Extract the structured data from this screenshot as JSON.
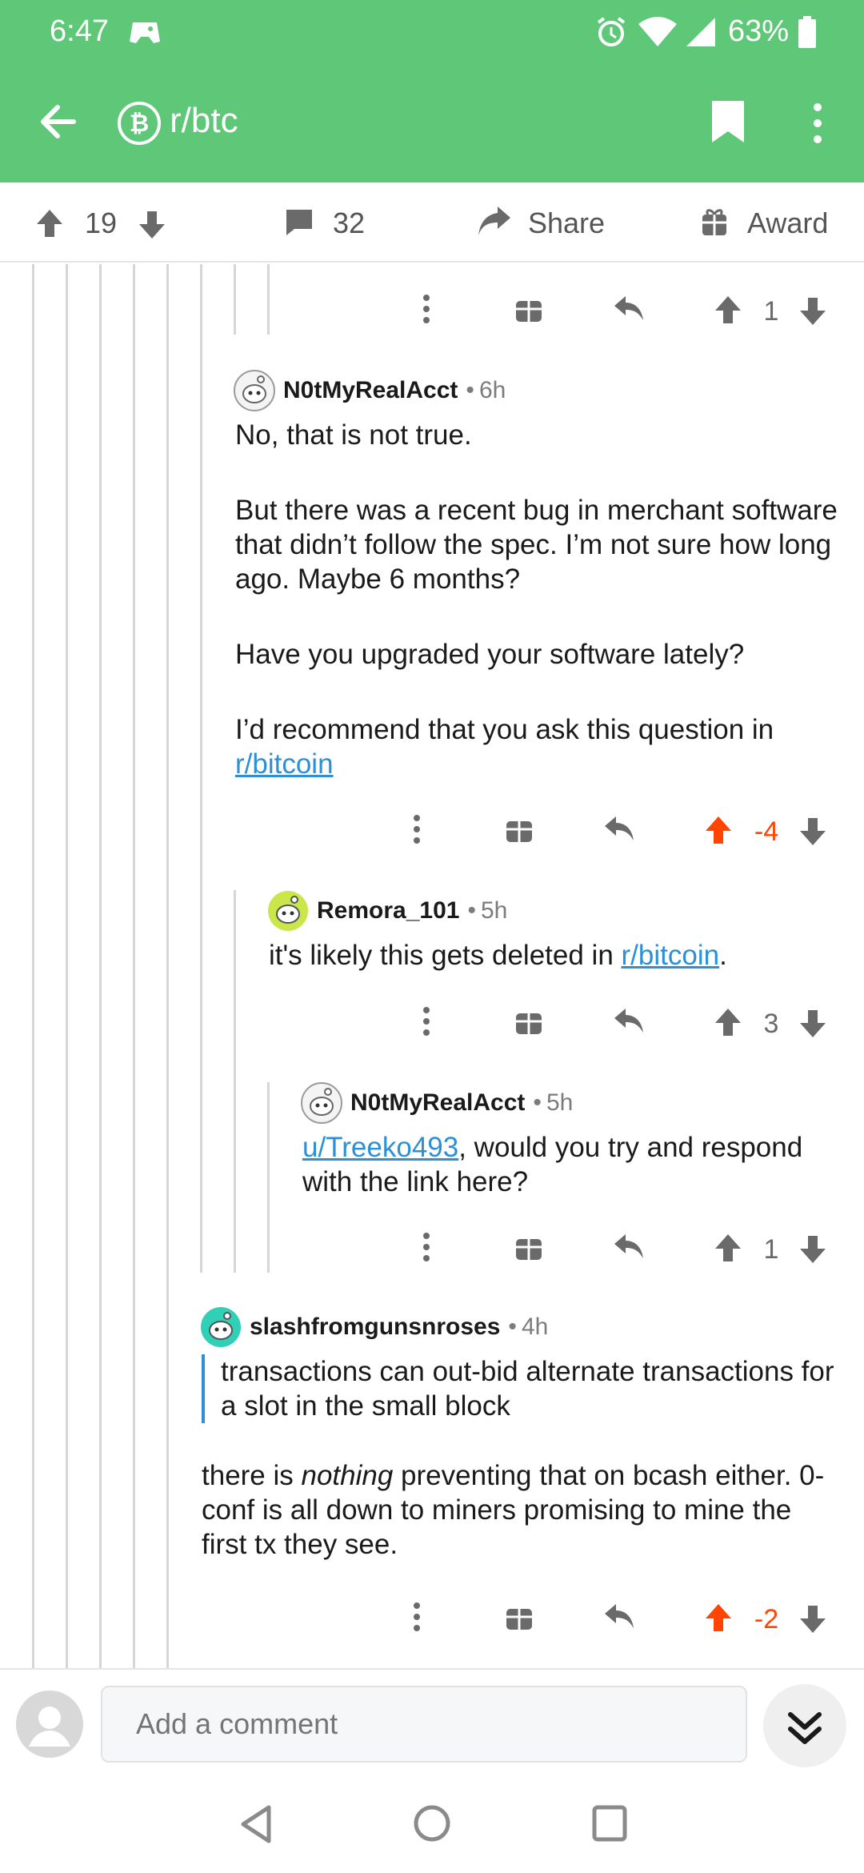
{
  "status_bar": {
    "time": "6:47",
    "battery": "63%"
  },
  "app_bar": {
    "subreddit": "r/btc",
    "back_icon": "arrow-left-icon",
    "bookmark_icon": "bookmark-icon",
    "menu_icon": "more-vert-icon"
  },
  "post_actions": {
    "score": "19",
    "comments": "32",
    "share_label": "Share",
    "award_label": "Award"
  },
  "comments": [
    {
      "id": "c0",
      "score": "1",
      "score_state": "neutral"
    },
    {
      "id": "c1",
      "author": "N0tMyRealAcct",
      "age": "6h",
      "paragraphs": [
        "No, that is not true.",
        "But there was a recent bug in merchant software that didn’t follow the spec. I’m not sure how long ago. Maybe 6 months?",
        "Have you upgraded your software lately?"
      ],
      "last_text": "I’d recommend that you ask this question in ",
      "last_link": "r/bitcoin",
      "score": "-4",
      "score_state": "upvoted"
    },
    {
      "id": "c2",
      "author": "Remora_101",
      "age": "5h",
      "text_before": "it's likely this gets deleted in ",
      "link": "r/bitcoin",
      "text_after": ".",
      "score": "3",
      "score_state": "neutral"
    },
    {
      "id": "c3",
      "author": "N0tMyRealAcct",
      "age": "5h",
      "link": "u/Treeko493",
      "text_after": ", would you try and respond with the link here?",
      "score": "1",
      "score_state": "neutral"
    },
    {
      "id": "c4",
      "author": "slashfromgunsnroses",
      "age": "4h",
      "quote": "transactions can out-bid alternate transactions for a slot in the small block",
      "text_before": "there is ",
      "emphasis": "nothing",
      "text_after": " preventing that on bcash either. 0-conf is all down to miners promising to mine the first tx they see.",
      "score": "-2",
      "score_state": "upvoted"
    }
  ],
  "composer": {
    "placeholder": "Add a comment"
  },
  "colors": {
    "header": "#5ec878",
    "link": "#2d8fd6",
    "upvote": "#ff4500",
    "thread_line": "#d6d6d6"
  }
}
